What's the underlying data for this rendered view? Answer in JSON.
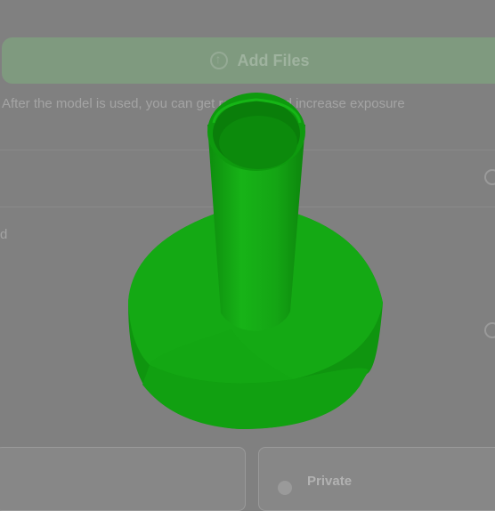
{
  "upload": {
    "button_label": "Add Files",
    "hint": "After the model is used, you can get rewards and increase exposure"
  },
  "form": {
    "side_label": "d"
  },
  "visibility": {
    "private_label": "Private"
  },
  "viewer": {
    "model_color": "#12a612",
    "background_color": "#808080"
  }
}
